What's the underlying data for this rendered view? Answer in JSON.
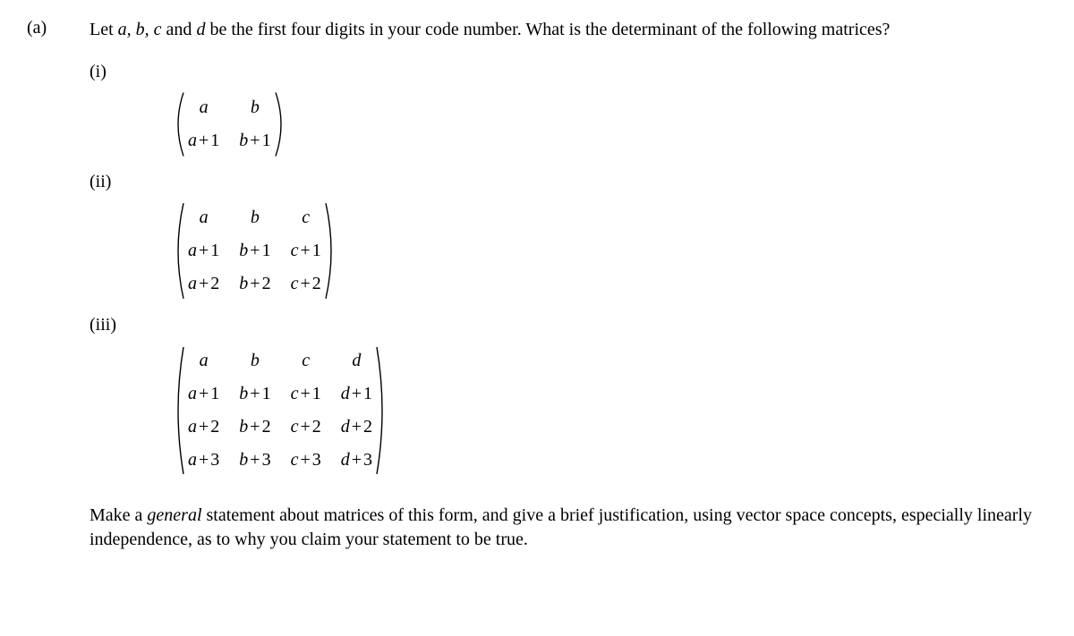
{
  "part_label": "(a)",
  "question_prefix": "Let ",
  "vars_abc": "a, b, c",
  "and_word": " and ",
  "var_d": "d",
  "question_mid": " be the first four digits in your code number. What is the determinant of the following matrices?",
  "sub": {
    "i": "(i)",
    "ii": "(ii)",
    "iii": "(iii)"
  },
  "m2": {
    "r1c1": "a",
    "r1c2": "b",
    "r2c1_a": "a",
    "r2c1_b": "1",
    "r2c2_a": "b",
    "r2c2_b": "1"
  },
  "m3": {
    "r1c1": "a",
    "r1c2": "b",
    "r1c3": "c",
    "r2c1_a": "a",
    "r2c1_b": "1",
    "r2c2_a": "b",
    "r2c2_b": "1",
    "r2c3_a": "c",
    "r2c3_b": "1",
    "r3c1_a": "a",
    "r3c1_b": "2",
    "r3c2_a": "b",
    "r3c2_b": "2",
    "r3c3_a": "c",
    "r3c3_b": "2"
  },
  "m4": {
    "r1c1": "a",
    "r1c2": "b",
    "r1c3": "c",
    "r1c4": "d",
    "r2c1_a": "a",
    "r2c1_b": "1",
    "r2c2_a": "b",
    "r2c2_b": "1",
    "r2c3_a": "c",
    "r2c3_b": "1",
    "r2c4_a": "d",
    "r2c4_b": "1",
    "r3c1_a": "a",
    "r3c1_b": "2",
    "r3c2_a": "b",
    "r3c2_b": "2",
    "r3c3_a": "c",
    "r3c3_b": "2",
    "r3c4_a": "d",
    "r3c4_b": "2",
    "r4c1_a": "a",
    "r4c1_b": "3",
    "r4c2_a": "b",
    "r4c2_b": "3",
    "r4c3_a": "c",
    "r4c3_b": "3",
    "r4c4_a": "d",
    "r4c4_b": "3"
  },
  "closing_prefix": "Make a ",
  "closing_general": "general",
  "closing_rest": " statement about matrices of this form, and give a brief justification, using vector space concepts, especially linearly independence, as to why you claim your statement to be true."
}
